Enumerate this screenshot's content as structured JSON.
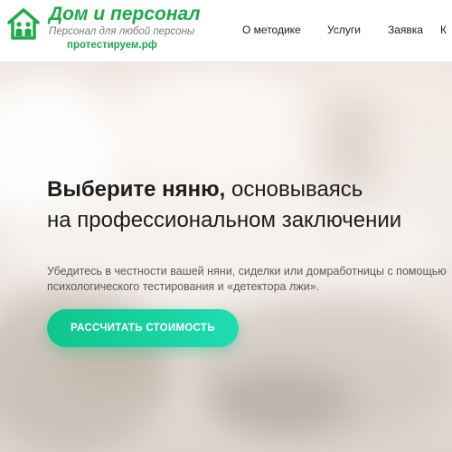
{
  "header": {
    "brand_title": "Дом и персонал",
    "brand_subtitle": "Персонал для любой персоны",
    "brand_link": "протестируем.рф",
    "nav": [
      "О методике",
      "Услуги",
      "Заявка",
      "К"
    ]
  },
  "hero": {
    "title_strong": "Выберите няню,",
    "title_rest": " основываясь",
    "title_line2": "на профессиональном заключении",
    "desc_line1": "Убедитесь в честности вашей няни, сиделки или домработницы с помощью",
    "desc_line2": "психологического тестирования и «детектора лжи».",
    "cta_label": "РАССЧИТАТЬ СТОИМОСТЬ"
  },
  "colors": {
    "brand_green": "#1ea94a",
    "cta_gradient_start": "#0fc58d",
    "cta_gradient_end": "#20dcb1"
  },
  "icons": [
    "house-people-logo-icon"
  ]
}
